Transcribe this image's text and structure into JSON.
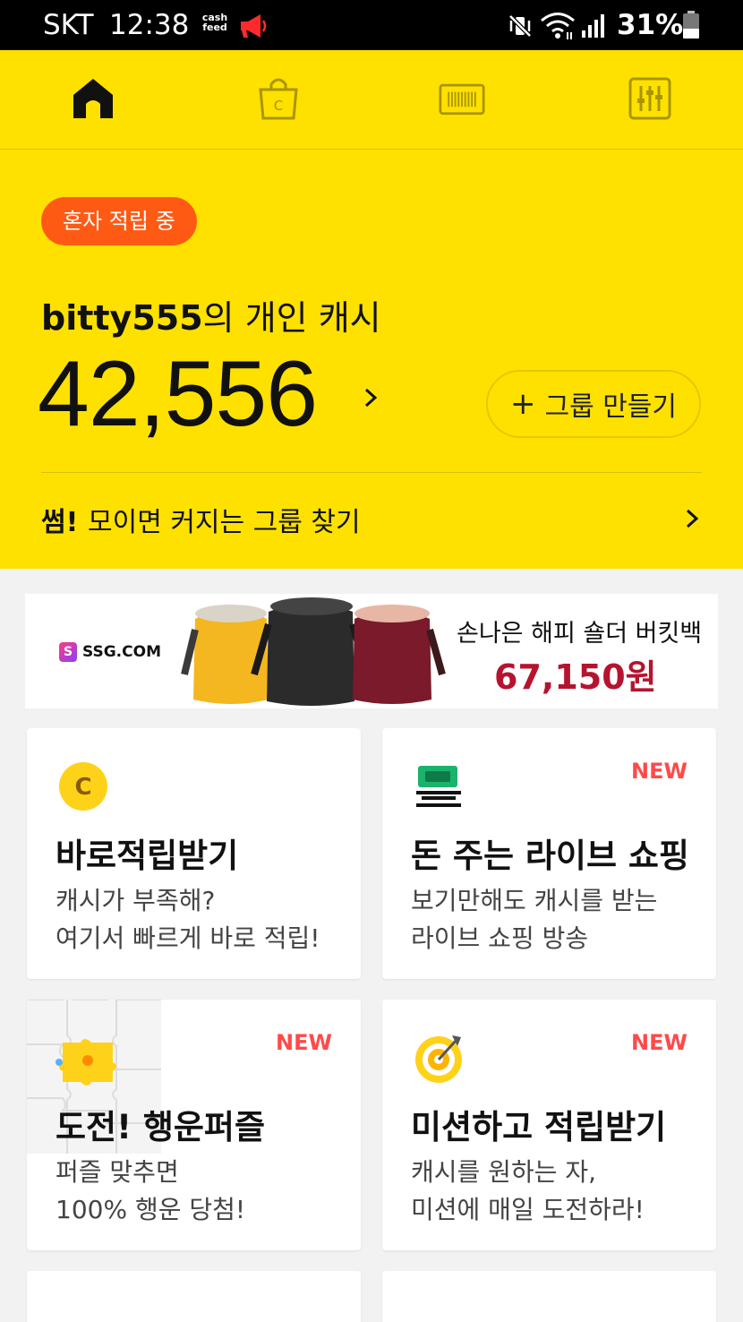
{
  "status_bar": {
    "carrier": "SKT",
    "time": "12:38",
    "app_badge": "cash feed",
    "battery": "31%"
  },
  "tabs": [
    {
      "icon": "home-icon",
      "active": true
    },
    {
      "icon": "shopping-bag-icon",
      "active": false
    },
    {
      "icon": "barcode-icon",
      "active": false
    },
    {
      "icon": "settings-sliders-icon",
      "active": false
    }
  ],
  "hero": {
    "badge": "혼자 적립 중",
    "owner_name": "bitty555",
    "owner_suffix": "의 개인 캐시",
    "balance": "42,556",
    "group_button_plus": "+",
    "group_button": "그룹 만들기",
    "find_brand": "썸!",
    "find_text": "모이면 커지는 그룹 찾기"
  },
  "ad": {
    "brand": "SSG.COM",
    "brand_mark": "S",
    "title": "손나은 해피 숄더 버킷백",
    "price": "67,150원"
  },
  "cards": [
    {
      "icon": "cash-coin-icon",
      "new": "",
      "title": "바로적립받기",
      "desc1": "캐시가 부족해?",
      "desc2": "여기서 빠르게 바로 적립!"
    },
    {
      "icon": "money-bill-icon",
      "new": "NEW",
      "title": "돈 주는 라이브 쇼핑",
      "desc1": "보기만해도 캐시를 받는",
      "desc2": "라이브 쇼핑 방송"
    },
    {
      "icon": "puzzle-icon",
      "new": "NEW",
      "title": "도전! 행운퍼즐",
      "desc1": "퍼즐 맞추면",
      "desc2": "100% 행운 당첨!"
    },
    {
      "icon": "target-icon",
      "new": "NEW",
      "title": "미션하고 적립받기",
      "desc1": "캐시를 원하는 자,",
      "desc2": "미션에 매일 도전하라!"
    },
    {
      "icon": "cart-icon"
    },
    {
      "icon": "dots-icon"
    }
  ],
  "colors": {
    "hero_bg": "#ffe100",
    "badge_bg": "#ff5a14",
    "new_label": "#ff4a4a",
    "ad_price": "#b5142f"
  }
}
